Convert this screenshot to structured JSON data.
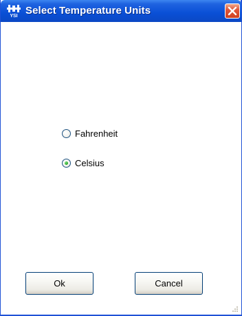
{
  "window": {
    "title": "Select Temperature Units",
    "icon": "ysi-app-icon"
  },
  "options": [
    {
      "label": "Fahrenheit",
      "selected": false
    },
    {
      "label": "Celsius",
      "selected": true
    }
  ],
  "buttons": {
    "ok_label": "Ok",
    "cancel_label": "Cancel"
  },
  "colors": {
    "titlebar": "#0a4fd6",
    "close_button": "#e0573a",
    "radio_selected": "#21a121"
  }
}
